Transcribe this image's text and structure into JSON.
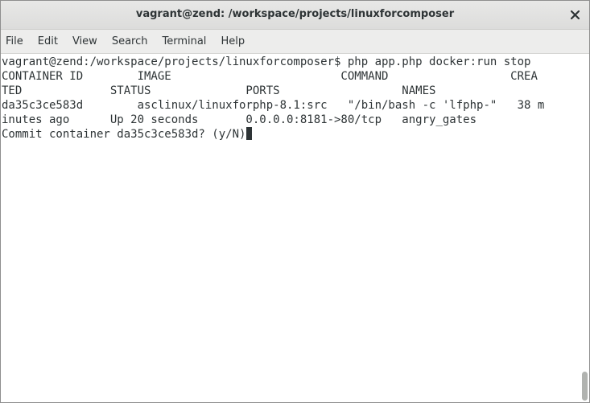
{
  "window": {
    "title": "vagrant@zend: /workspace/projects/linuxforcomposer"
  },
  "menubar": {
    "items": [
      "File",
      "Edit",
      "View",
      "Search",
      "Terminal",
      "Help"
    ]
  },
  "terminal": {
    "lines": [
      "vagrant@zend:/workspace/projects/linuxforcomposer$ php app.php docker:run stop",
      "CONTAINER ID        IMAGE                         COMMAND                  CREA",
      "TED             STATUS              PORTS                  NAMES",
      "da35c3ce583d        asclinux/linuxforphp-8.1:src   \"/bin/bash -c 'lfphp-\"   38 m",
      "inutes ago      Up 20 seconds       0.0.0.0:8181->80/tcp   angry_gates",
      "Commit container da35c3ce583d? (y/N)"
    ]
  },
  "colors": {
    "text": "#2e3436",
    "background": "#ffffff",
    "titlebar": "#e0e0df",
    "menubar": "#ededec"
  },
  "icons": {
    "close": "close-icon"
  }
}
